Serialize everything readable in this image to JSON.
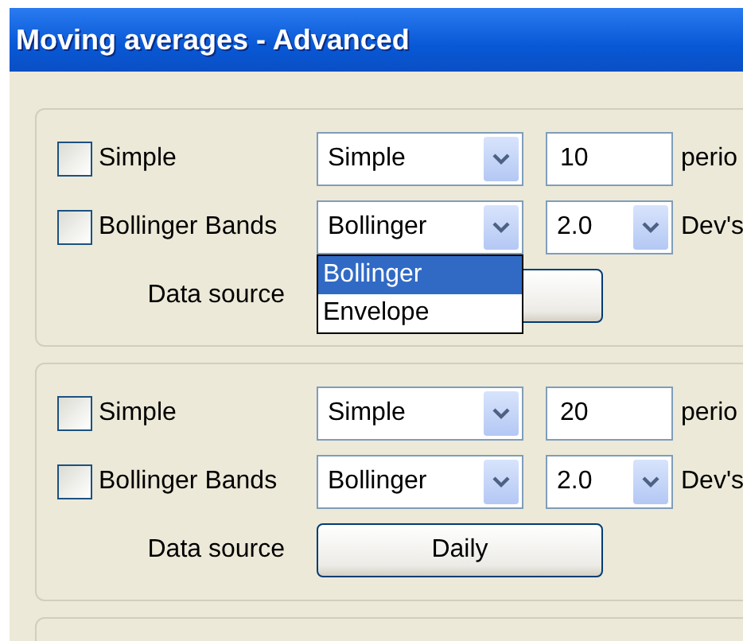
{
  "window": {
    "title": "Moving averages - Advanced"
  },
  "groups": [
    {
      "kind": "full",
      "rows": [
        {
          "label": "Simple",
          "checked": false,
          "combo": "Simple",
          "kind": "text",
          "value": "10",
          "unit": "perio"
        },
        {
          "label": "Bollinger Bands",
          "checked": false,
          "combo": "Bollinger",
          "kind": "combo",
          "value": "2.0",
          "unit": "Dev's",
          "open_list": [
            {
              "label": "Bollinger",
              "selected": true
            },
            {
              "label": "Envelope",
              "selected": false
            }
          ]
        }
      ],
      "source_label": "Data source"
    },
    {
      "kind": "full",
      "rows": [
        {
          "label": "Simple",
          "checked": false,
          "combo": "Simple",
          "kind": "text",
          "value": "20",
          "unit": "perio"
        },
        {
          "label": "Bollinger Bands",
          "checked": false,
          "combo": "Bollinger",
          "kind": "combo",
          "value": "2.0",
          "unit": "Dev's"
        }
      ],
      "source_label": "Data source",
      "source_button": "Daily"
    },
    {
      "kind": "cut"
    }
  ]
}
